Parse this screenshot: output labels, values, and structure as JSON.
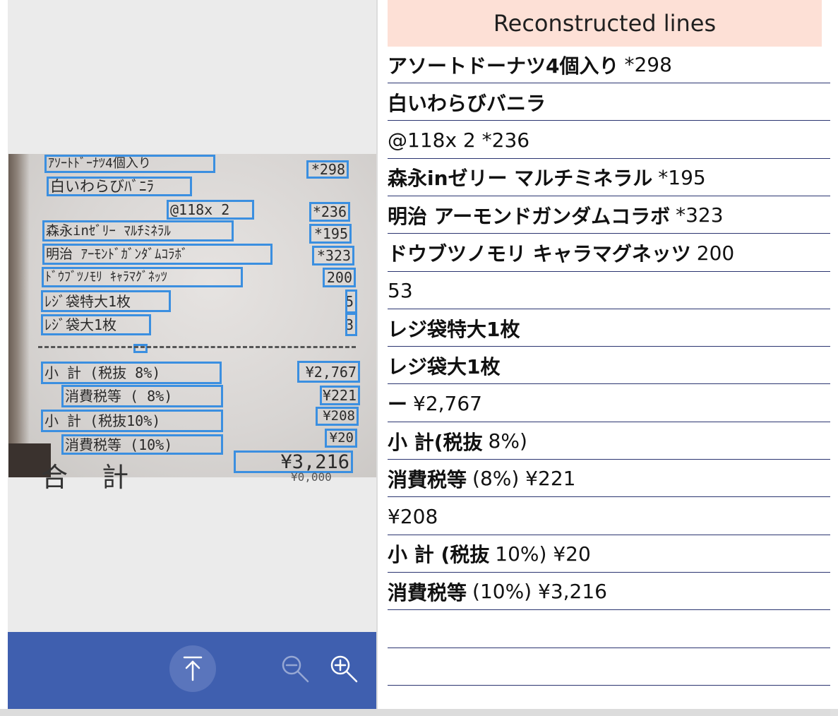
{
  "panel": {
    "header": "Reconstructed lines"
  },
  "lines": [
    {
      "b": "アソートドーナツ4個入り",
      "t": "*298"
    },
    {
      "b": "白いわらびバニラ",
      "t": ""
    },
    {
      "b": "",
      "t": "@118x 2 *236"
    },
    {
      "b": "森永inゼリー マルチミネラル",
      "t": "*195"
    },
    {
      "b": "明治 アーモンドガンダムコラボ",
      "t": "*323"
    },
    {
      "b": "ドウブツノモリ キャラマグネッツ",
      "t": "200"
    },
    {
      "b": "",
      "t": "53"
    },
    {
      "b": "レジ袋特大1枚",
      "t": ""
    },
    {
      "b": "レジ袋大1枚",
      "t": ""
    },
    {
      "b": "ー",
      "t": "¥2,767"
    },
    {
      "b": "小 計(税抜",
      "t": "8%)"
    },
    {
      "b": "消費税等",
      "t": "(8%) ¥221"
    },
    {
      "b": "",
      "t": "¥208"
    },
    {
      "b": "小 計 (税抜",
      "t": "10%) ¥20"
    },
    {
      "b": "消費税等",
      "t": "(10%) ¥3,216"
    },
    {
      "b": "",
      "t": ""
    },
    {
      "b": "",
      "t": ""
    }
  ],
  "receipt": {
    "boxes": [
      {
        "text": "ｱｿｰﾄﾄﾞｰﾅﾂ4個入り"
      },
      {
        "text": "*298"
      },
      {
        "text": "白いわらびﾊﾞﾆﾗ"
      },
      {
        "text": "@118x  2"
      },
      {
        "text": "*236"
      },
      {
        "text": "森永inｾﾞﾘｰ ﾏﾙﾁﾐﾈﾗﾙ"
      },
      {
        "text": "*195"
      },
      {
        "text": "明治  ｱｰﾓﾝﾄﾞｶﾞﾝﾀﾞﾑｺﾗﾎﾞ"
      },
      {
        "text": "*323"
      },
      {
        "text": "ﾄﾞｳﾌﾞﾂﾉﾓﾘ ｷｬﾗﾏｸﾞﾈｯﾂ"
      },
      {
        "text": "200"
      },
      {
        "text": "ﾚｼﾞ袋特大1枚"
      },
      {
        "text": "5"
      },
      {
        "text": "ﾚｼﾞ袋大1枚"
      },
      {
        "text": "3"
      },
      {
        "text": ""
      },
      {
        "text": "小  計 (税抜  8%)"
      },
      {
        "text": "¥2,767"
      },
      {
        "text": "消費税等 (  8%)"
      },
      {
        "text": "¥221"
      },
      {
        "text": "小  計 (税抜10%)"
      },
      {
        "text": "¥208"
      },
      {
        "text": "消費税等 (10%)"
      },
      {
        "text": "¥20"
      },
      {
        "text": "¥3,216"
      }
    ],
    "total_label": "合 計",
    "faint_text": "¥0,000"
  },
  "toolbar": {
    "scroll_top_icon": "arrow-up-to-line-icon",
    "zoom_out_icon": "zoom-out-icon",
    "zoom_in_icon": "zoom-in-icon"
  },
  "colors": {
    "ocr_box": "#3b8fe0",
    "toolbar": "#3f5faf",
    "header_bg": "#fde0d6",
    "row_border": "#2a3470"
  }
}
